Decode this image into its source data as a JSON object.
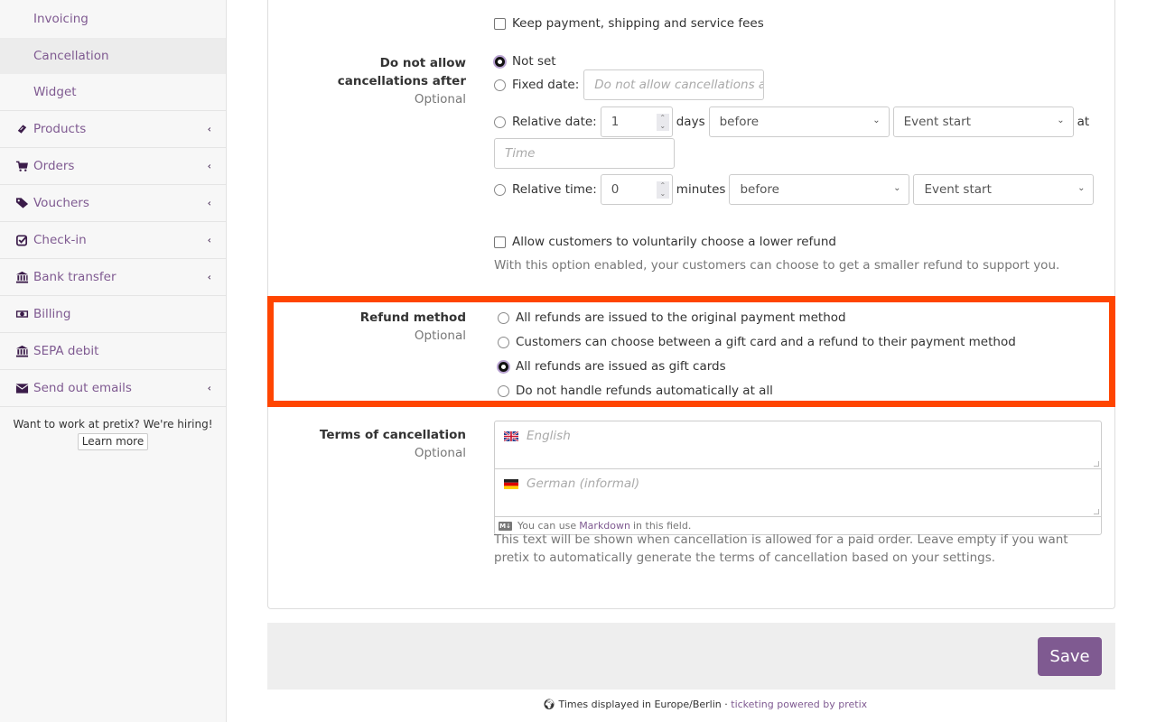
{
  "sidebar": {
    "sub_items": [
      {
        "label": "Invoicing",
        "active": false
      },
      {
        "label": "Cancellation",
        "active": true
      },
      {
        "label": "Widget",
        "active": false
      }
    ],
    "items": [
      {
        "label": "Products",
        "icon": "ticket-icon",
        "has_children": true
      },
      {
        "label": "Orders",
        "icon": "cart-icon",
        "has_children": true
      },
      {
        "label": "Vouchers",
        "icon": "tags-icon",
        "has_children": true
      },
      {
        "label": "Check-in",
        "icon": "check-square-icon",
        "has_children": true
      },
      {
        "label": "Bank transfer",
        "icon": "bank-icon",
        "has_children": true
      },
      {
        "label": "Billing",
        "icon": "money-icon",
        "has_children": false
      },
      {
        "label": "SEPA debit",
        "icon": "bank-icon",
        "has_children": false
      },
      {
        "label": "Send out emails",
        "icon": "envelope-icon",
        "has_children": true
      }
    ],
    "hiring_text": "Want to work at pretix? We're hiring!",
    "learn_more": "Learn more",
    "chevron": "‹"
  },
  "form": {
    "keep_fees": {
      "label": "Keep payment, shipping and service fees",
      "checked": false
    },
    "no_cancel_after": {
      "label": "Do not allow cancellations after",
      "optional": "Optional",
      "options": {
        "not_set": {
          "label": "Not set",
          "checked": true
        },
        "fixed_date": {
          "label": "Fixed date:",
          "placeholder": "Do not allow cancellations after",
          "checked": false
        },
        "relative_date": {
          "label": "Relative date:",
          "value": "1",
          "unit": "days",
          "direction": "before",
          "base": "Event start",
          "at": "at",
          "time_placeholder": "Time",
          "checked": false
        },
        "relative_time": {
          "label": "Relative time:",
          "value": "0",
          "unit": "minutes",
          "direction": "before",
          "base": "Event start",
          "checked": false
        }
      }
    },
    "lower_refund": {
      "label": "Allow customers to voluntarily choose a lower refund",
      "checked": false,
      "help": "With this option enabled, your customers can choose to get a smaller refund to support you."
    },
    "refund_method": {
      "label": "Refund method",
      "optional": "Optional",
      "options": [
        {
          "label": "All refunds are issued to the original payment method",
          "checked": false
        },
        {
          "label": "Customers can choose between a gift card and a refund to their payment method",
          "checked": false
        },
        {
          "label": "All refunds are issued as gift cards",
          "checked": true
        },
        {
          "label": "Do not handle refunds automatically at all",
          "checked": false
        }
      ],
      "highlight_color": "#ff4500"
    },
    "terms": {
      "label": "Terms of cancellation",
      "optional": "Optional",
      "english_placeholder": "English",
      "german_placeholder": "German (informal)",
      "markdown_prefix": "You can use",
      "markdown_link": "Markdown",
      "markdown_suffix": "in this field.",
      "markdown_badge": "M↓",
      "help": "This text will be shown when cancellation is allowed for a paid order. Leave empty if you want pretix to automatically generate the terms of cancellation based on your settings."
    }
  },
  "save_label": "Save",
  "footer": {
    "timezone_text": "Times displayed in Europe/Berlin ·",
    "powered_link": "ticketing powered by pretix"
  },
  "colors": {
    "brand": "#7f5a91",
    "highlight": "#ff4500"
  }
}
